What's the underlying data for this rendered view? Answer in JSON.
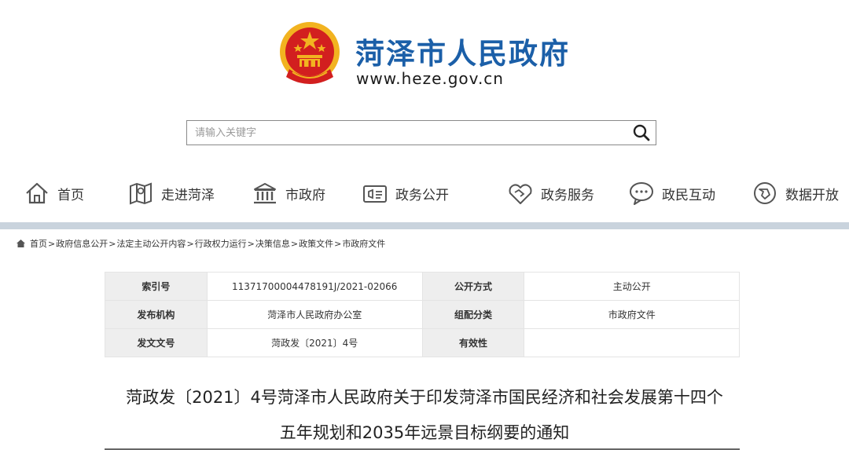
{
  "header": {
    "site_name": "菏泽市人民政府",
    "site_url": "www.heze.gov.cn",
    "emblem_icon": "national-emblem-icon"
  },
  "search": {
    "placeholder": "请输入关键字",
    "icon": "search-icon"
  },
  "nav": {
    "items": [
      {
        "label": "首页",
        "icon": "home-icon"
      },
      {
        "label": "走进菏泽",
        "icon": "map-icon"
      },
      {
        "label": "市政府",
        "icon": "government-building-icon"
      },
      {
        "label": "政务公开",
        "icon": "announcement-icon"
      },
      {
        "label": "政务服务",
        "icon": "handshake-icon"
      },
      {
        "label": "政民互动",
        "icon": "chat-icon"
      },
      {
        "label": "数据开放",
        "icon": "data-globe-icon"
      }
    ]
  },
  "breadcrumb": {
    "items": [
      "首页",
      "政府信息公开",
      "法定主动公开内容",
      "行政权力运行",
      "决策信息",
      "政策文件",
      "市政府文件"
    ],
    "separator": ">"
  },
  "meta_table": {
    "rows": [
      {
        "k1": "索引号",
        "v1": "11371700004478191J/2021-02066",
        "k2": "公开方式",
        "v2": "主动公开"
      },
      {
        "k1": "发布机构",
        "v1": "菏泽市人民政府办公室",
        "k2": "组配分类",
        "v2": "市政府文件"
      },
      {
        "k1": "发文文号",
        "v1": "菏政发〔2021〕4号",
        "k2": "有效性",
        "v2": ""
      }
    ]
  },
  "document": {
    "title_line1": "菏政发〔2021〕4号菏泽市人民政府关于印发菏泽市国民经济和社会发展第十四个",
    "title_line2": "五年规划和2035年远景目标纲要的通知"
  },
  "colors": {
    "brand": "#1b5fa8",
    "nav_bar": "#c9d3dd",
    "table_key_bg": "#eeeeee",
    "emblem_red": "#d21f1f",
    "emblem_gold": "#f2b320"
  }
}
